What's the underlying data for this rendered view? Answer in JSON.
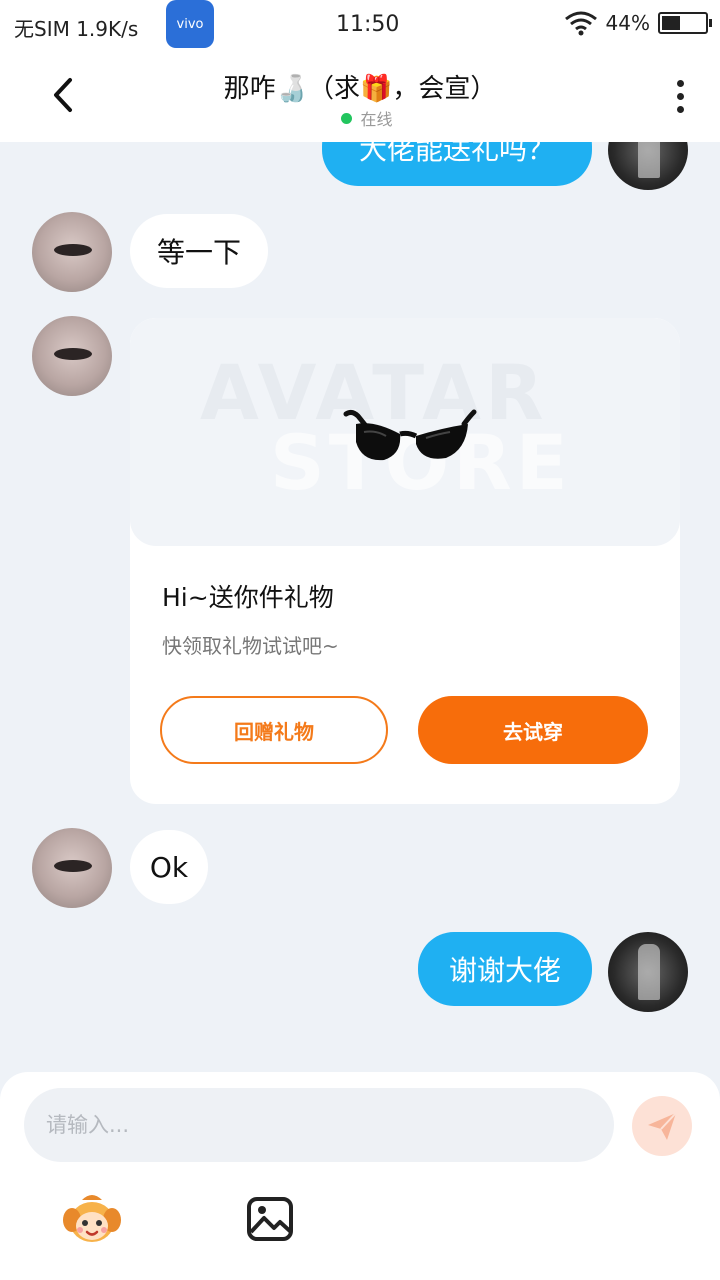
{
  "status_bar": {
    "carrier": "无SIM 1.9K/s",
    "vendor_badge": "vivo",
    "time": "11:50",
    "battery": "44%",
    "battery_level": 0.44
  },
  "header": {
    "title": "那咋🍶（求🎁，会宣）",
    "status": "在线",
    "back_icon": "chevron-left-icon",
    "more_icon": "more-vertical-icon"
  },
  "messages": [
    {
      "side": "right",
      "text": "大佬能送礼吗？"
    },
    {
      "side": "left",
      "text": "等一下"
    },
    {
      "side": "left",
      "type": "gift_card"
    },
    {
      "side": "left",
      "text": "Ok"
    },
    {
      "side": "right",
      "text": "谢谢大佬"
    }
  ],
  "gift_card": {
    "watermark_top": "AVATAR",
    "watermark_bottom": "STORE",
    "item_icon": "sunglasses-icon",
    "title": "Hi~送你件礼物",
    "subtitle": "快领取礼物试试吧~",
    "return_gift_label": "回赠礼物",
    "try_on_label": "去试穿"
  },
  "input": {
    "placeholder": "请输入...",
    "value": ""
  },
  "toolbar": {
    "emoji_icon": "emoji-icon",
    "image_icon": "image-icon",
    "send_icon": "send-icon"
  },
  "colors": {
    "right_bubble": "#1fb0f2",
    "accent_orange": "#f76d0b",
    "online": "#22c55e"
  }
}
